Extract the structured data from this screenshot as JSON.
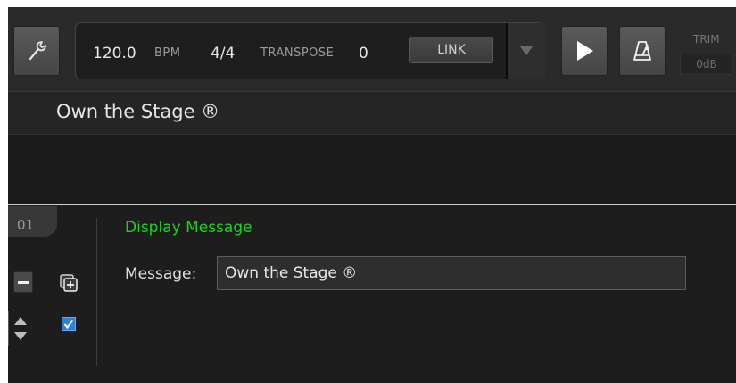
{
  "toolbar": {
    "tempo_value": "120.0",
    "tempo_unit": "BPM",
    "time_signature": "4/4",
    "transpose_label": "TRANSPOSE",
    "transpose_value": "0",
    "link_label": "LINK",
    "trim_label": "TRIM",
    "trim_value": "0dB"
  },
  "song": {
    "title": "Own the Stage ®"
  },
  "action": {
    "step_number": "01",
    "type_label": "Display Message",
    "message_label": "Message:",
    "message_value": "Own the Stage ®",
    "enabled": true,
    "accent_color": "#1fd11f"
  },
  "icons": {
    "settings": "wrench-icon",
    "dropdown": "triangle-down-icon",
    "play": "play-icon",
    "metronome": "metronome-icon",
    "remove": "minus-icon",
    "duplicate": "duplicate-icon",
    "reorder": "up-down-arrows-icon",
    "enabled": "checkbox-checked-icon"
  }
}
